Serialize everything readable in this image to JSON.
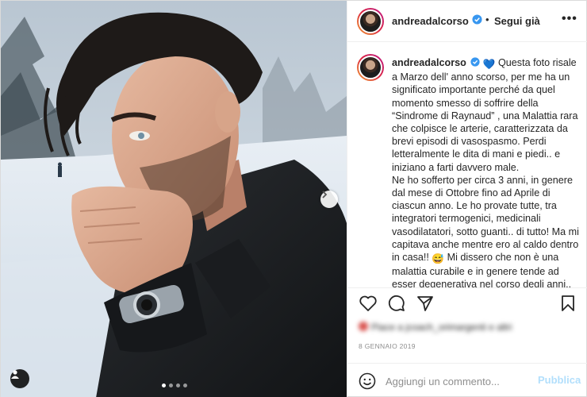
{
  "post": {
    "username": "andreadalcorso",
    "follow_label": "Segui già",
    "bullet": "•",
    "more_label": "•••",
    "caption_emoji": "💙",
    "caption_1": "Questa foto risale a Marzo dell' anno scorso, per me ha un significato importante perché da quel momento smesso di soffrire della “Sindrome di Raynaud” , una Malattia rara che colpisce le arterie, caratterizzata da brevi episodi di vasospasmo. Perdi letteralmente le dita di mani e piedi.. e iniziano a farti davvero male.",
    "caption_2": "Ne ho sofferto per circa 3 anni, in genere dal mese di Ottobre fino ad Aprile di ciascun anno. Le ho provate tutte, tra integratori termogenici, medicinali vasodilatatori, sotto guanti.. di tutto! Ma mi capitava anche mentre ero al caldo dentro in casa!!",
    "caption_emoji_2": "😅",
    "caption_3": "Mi dissero che non è una malattia curabile e in genere tende ad esser degenerativa nel corso degli anni..",
    "likes_text": "Piace a jcoach_orimargenti e altri",
    "date": "8 GENNAIO 2019"
  },
  "comment": {
    "placeholder": "Aggiungi un commento...",
    "publish_label": "Pubblica"
  },
  "icons": {
    "verified": "verified-badge-icon",
    "like": "heart-icon",
    "comment": "comment-icon",
    "share": "paper-plane-icon",
    "save": "bookmark-icon",
    "emoji": "smiley-icon",
    "next": "chevron-right-icon",
    "tag": "user-tag-icon"
  },
  "colors": {
    "verified_blue": "#3897f0",
    "publish_disabled": "#b2dffc",
    "date_gray": "#8e8e8e"
  },
  "carousel": {
    "slide_count": 4,
    "active_index": 0
  }
}
